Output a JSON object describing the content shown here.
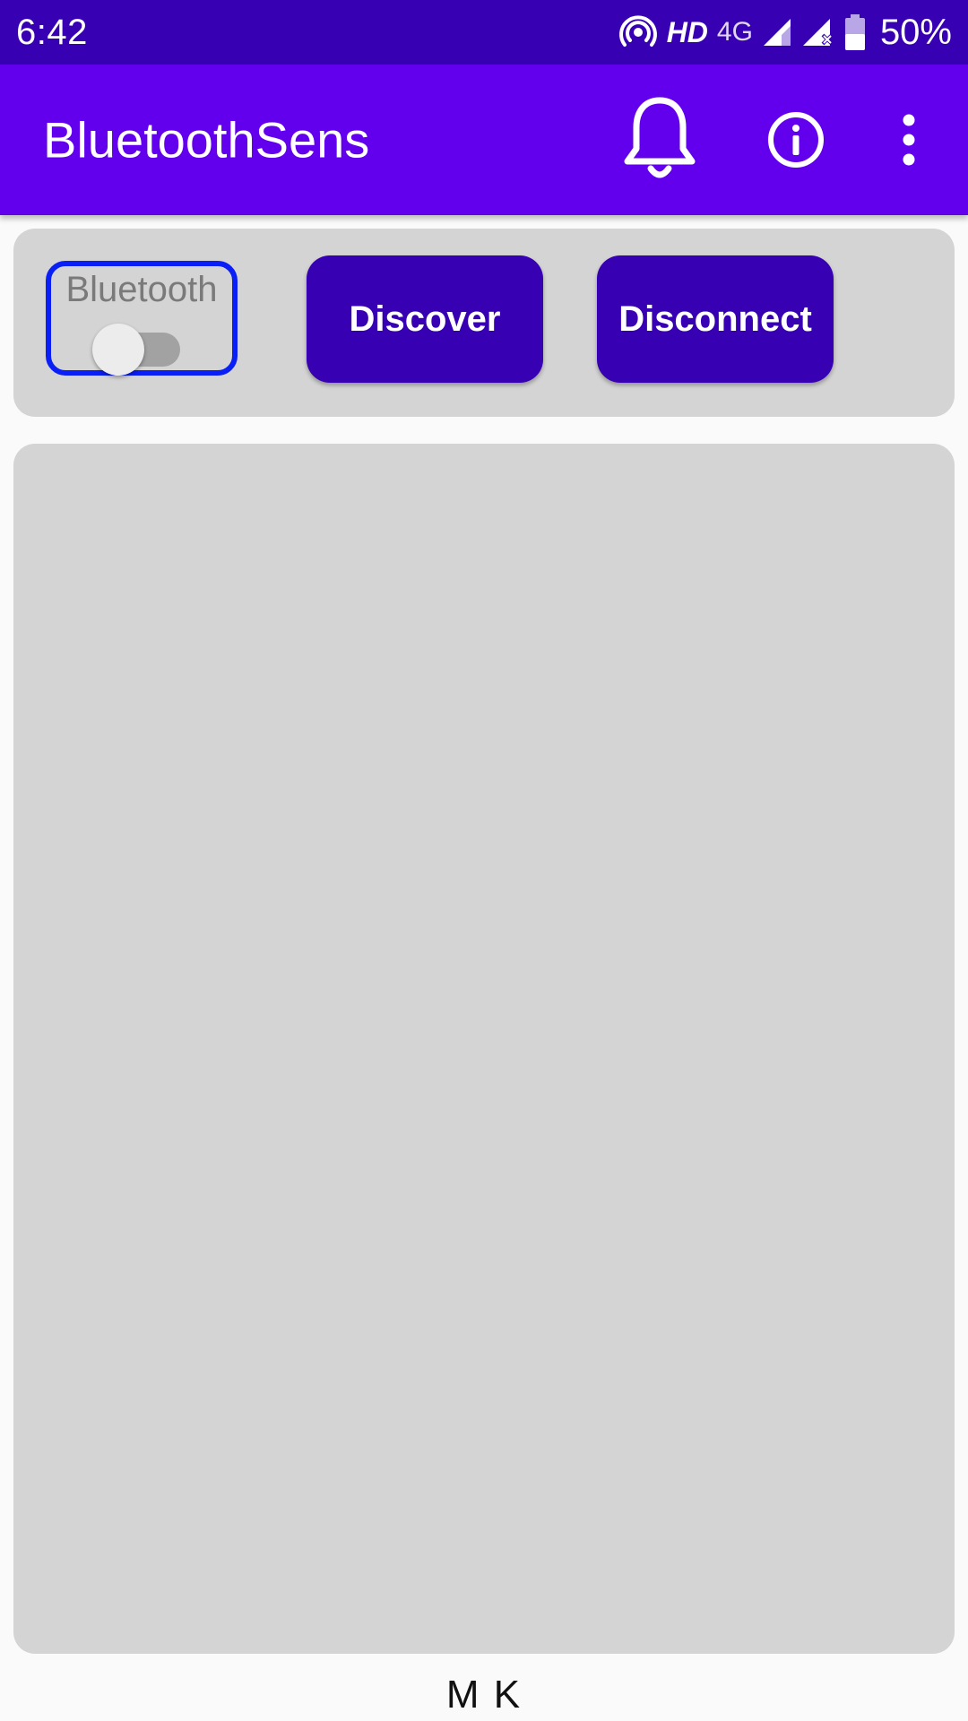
{
  "status_bar": {
    "time": "6:42",
    "hd_label": "HD",
    "network_label": "4G",
    "battery_text": "50%",
    "icons": [
      "hotspot-icon",
      "signal-icon",
      "signal-no-data-icon",
      "battery-icon"
    ]
  },
  "app_bar": {
    "title": "BluetoothSens",
    "actions": [
      "bell-icon",
      "info-icon",
      "more-vert-icon"
    ]
  },
  "controls": {
    "bluetooth_label": "Bluetooth",
    "bluetooth_enabled": false,
    "discover_label": "Discover",
    "disconnect_label": "Disconnect"
  },
  "device_list": {
    "items": []
  },
  "footer": {
    "text": "M K"
  },
  "colors": {
    "status_bar": "#3700b3",
    "app_bar": "#6200ee",
    "button": "#3700b3",
    "switch_outline": "#0a1ff5",
    "panel": "#d4d4d4",
    "background": "#fafafa"
  }
}
